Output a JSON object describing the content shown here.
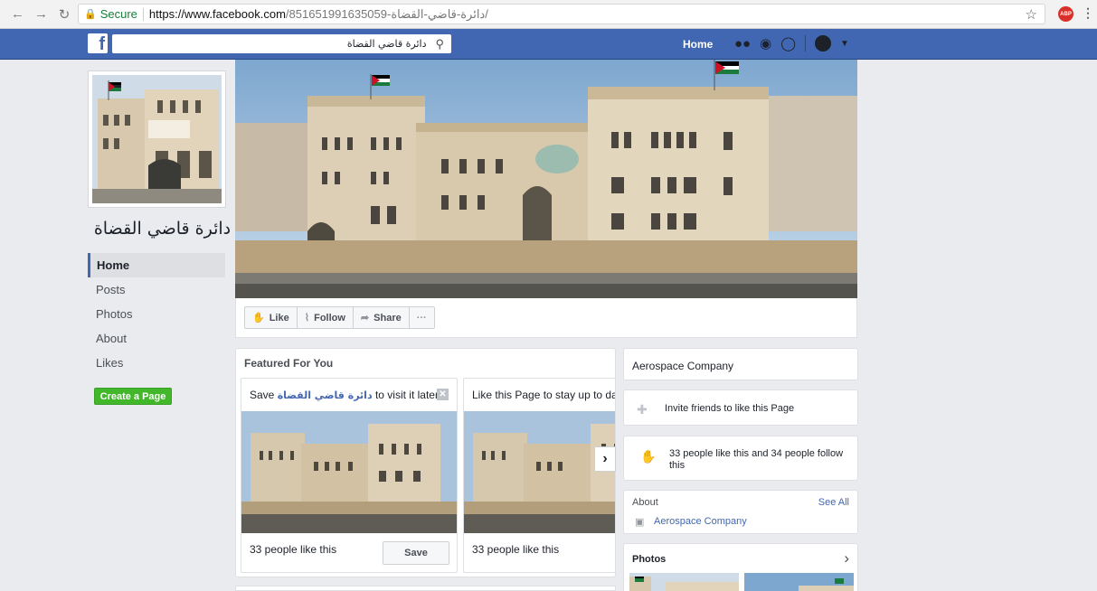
{
  "browser": {
    "secure_label": "Secure",
    "url_host": "https://www.facebook.com",
    "url_path": "/851651991635059-دائرة-قاضي-القضاة/",
    "abp_label": "ABP"
  },
  "topbar": {
    "search_value": "دائرة قاضي القضاة",
    "home_label": "Home"
  },
  "page": {
    "name": "دائرة قاضي القضاة"
  },
  "leftnav": {
    "items": [
      "Home",
      "Posts",
      "Photos",
      "About",
      "Likes"
    ],
    "create_page": "Create a Page"
  },
  "actions": {
    "like": "Like",
    "follow": "Follow",
    "share": "Share",
    "more": "···"
  },
  "featured": {
    "header": "Featured For You",
    "card1": {
      "title_pre": "Save ",
      "title_link": "دائرة قاضي القضاة",
      "title_post": " to visit it later",
      "likes": "33 people like this",
      "save": "Save"
    },
    "card2": {
      "title": "Like this Page to stay up to date",
      "likes": "33 people like this"
    }
  },
  "sidebar": {
    "category": "Aerospace Company",
    "invite": "Invite friends to like this Page",
    "likes_follow": "33 people like this and 34 people follow this",
    "about_label": "About",
    "see_all": "See All",
    "about_category": "Aerospace Company",
    "photos_label": "Photos"
  },
  "colors": {
    "facebook_blue": "#4267b2",
    "create_green": "#42b72a",
    "background": "#e9ebee"
  }
}
